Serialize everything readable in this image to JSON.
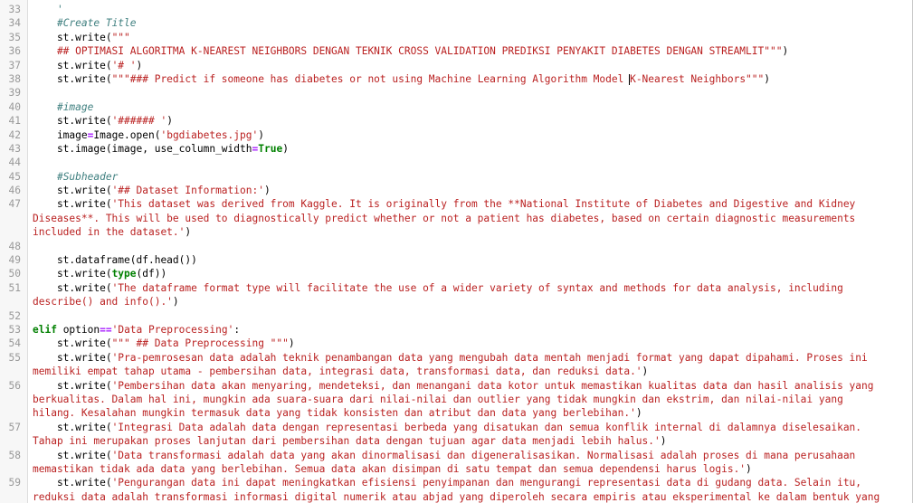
{
  "lines": [
    {
      "n": "33",
      "tokens": [
        {
          "t": "    ' ",
          "c": "cm"
        }
      ]
    },
    {
      "n": "34",
      "tokens": [
        {
          "t": "    "
        },
        {
          "t": "#Create Title",
          "c": "cm"
        }
      ]
    },
    {
      "n": "35",
      "tokens": [
        {
          "t": "    st.write("
        },
        {
          "t": "\"\"\"",
          "c": "str"
        }
      ]
    },
    {
      "n": "36",
      "tokens": [
        {
          "t": "    ## OPTIMASI ALGORITMA K-NEAREST NEIGHBORS DENGAN TEKNIK CROSS VALIDATION PREDIKSI PENYAKIT DIABETES DENGAN STREAMLIT\"\"\"",
          "c": "str"
        },
        {
          "t": ")"
        }
      ]
    },
    {
      "n": "37",
      "tokens": [
        {
          "t": "    st.write("
        },
        {
          "t": "'# '",
          "c": "str"
        },
        {
          "t": ")"
        }
      ]
    },
    {
      "n": "38",
      "tokens": [
        {
          "t": "    st.write("
        },
        {
          "t": "\"\"\"### Predict if someone has diabetes or not using Machine Learning Algorithm Model ",
          "c": "str"
        },
        {
          "t": "|",
          "c": "cursor"
        },
        {
          "t": "K-Nearest Neighbors\"\"\"",
          "c": "str"
        },
        {
          "t": ")"
        }
      ]
    },
    {
      "n": "39",
      "tokens": []
    },
    {
      "n": "40",
      "tokens": [
        {
          "t": "    "
        },
        {
          "t": "#image",
          "c": "cm"
        }
      ]
    },
    {
      "n": "41",
      "tokens": [
        {
          "t": "    st.write("
        },
        {
          "t": "'###### '",
          "c": "str"
        },
        {
          "t": ")"
        }
      ]
    },
    {
      "n": "42",
      "tokens": [
        {
          "t": "    image"
        },
        {
          "t": "=",
          "c": "op"
        },
        {
          "t": "Image.open("
        },
        {
          "t": "'bgdiabetes.jpg'",
          "c": "str"
        },
        {
          "t": ")"
        }
      ]
    },
    {
      "n": "43",
      "tokens": [
        {
          "t": "    st.image(image, use_column_width"
        },
        {
          "t": "=",
          "c": "op"
        },
        {
          "t": "True",
          "c": "kw"
        },
        {
          "t": ")"
        }
      ]
    },
    {
      "n": "44",
      "tokens": []
    },
    {
      "n": "45",
      "tokens": [
        {
          "t": "    "
        },
        {
          "t": "#Subheader",
          "c": "cm"
        }
      ]
    },
    {
      "n": "46",
      "tokens": [
        {
          "t": "    st.write("
        },
        {
          "t": "'## Dataset Information:'",
          "c": "str"
        },
        {
          "t": ")"
        }
      ]
    },
    {
      "n": "47",
      "tokens": [
        {
          "t": "    st.write("
        },
        {
          "t": "'This dataset was derived from Kaggle. It is originally from the **National Institute of Diabetes and Digestive and Kidney",
          "c": "str"
        }
      ]
    },
    {
      "n": "",
      "tokens": [
        {
          "t": "Diseases**. This will be used to diagnostically predict whether or not a patient has diabetes, based on certain diagnostic measurements",
          "c": "str"
        }
      ]
    },
    {
      "n": "",
      "tokens": [
        {
          "t": "included in the dataset.'",
          "c": "str"
        },
        {
          "t": ")"
        }
      ]
    },
    {
      "n": "48",
      "tokens": []
    },
    {
      "n": "49",
      "tokens": [
        {
          "t": "    st.dataframe(df.head())"
        }
      ]
    },
    {
      "n": "50",
      "tokens": [
        {
          "t": "    st.write("
        },
        {
          "t": "type",
          "c": "kw"
        },
        {
          "t": "(df))"
        }
      ]
    },
    {
      "n": "51",
      "tokens": [
        {
          "t": "    st.write("
        },
        {
          "t": "'The dataframe format type will facilitate the use of a wider variety of syntax and methods for data analysis, including",
          "c": "str"
        }
      ]
    },
    {
      "n": "",
      "tokens": [
        {
          "t": "describe() and info().'",
          "c": "str"
        },
        {
          "t": ")"
        }
      ]
    },
    {
      "n": "52",
      "tokens": []
    },
    {
      "n": "53",
      "tokens": [
        {
          "t": "elif",
          "c": "kw"
        },
        {
          "t": " option"
        },
        {
          "t": "==",
          "c": "op"
        },
        {
          "t": "'Data Preprocessing'",
          "c": "str"
        },
        {
          "t": ":"
        }
      ]
    },
    {
      "n": "54",
      "tokens": [
        {
          "t": "    st.write("
        },
        {
          "t": "\"\"\" ## Data Preprocessing \"\"\"",
          "c": "str"
        },
        {
          "t": ")"
        }
      ]
    },
    {
      "n": "55",
      "tokens": [
        {
          "t": "    st.write("
        },
        {
          "t": "'Pra-pemrosesan data adalah teknik penambangan data yang mengubah data mentah menjadi format yang dapat dipahami. Proses ini",
          "c": "str"
        }
      ]
    },
    {
      "n": "",
      "tokens": [
        {
          "t": "memiliki empat tahap utama - pembersihan data, integrasi data, transformasi data, dan reduksi data.'",
          "c": "str"
        },
        {
          "t": ")"
        }
      ]
    },
    {
      "n": "56",
      "tokens": [
        {
          "t": "    st.write("
        },
        {
          "t": "'Pembersihan data akan menyaring, mendeteksi, dan menangani data kotor untuk memastikan kualitas data dan hasil analisis yang",
          "c": "str"
        }
      ]
    },
    {
      "n": "",
      "tokens": [
        {
          "t": "berkualitas. Dalam hal ini, mungkin ada suara-suara dari nilai-nilai dan outlier yang tidak mungkin dan ekstrim, dan nilai-nilai yang",
          "c": "str"
        }
      ]
    },
    {
      "n": "",
      "tokens": [
        {
          "t": "hilang. Kesalahan mungkin termasuk data yang tidak konsisten dan atribut dan data yang berlebihan.'",
          "c": "str"
        },
        {
          "t": ")"
        }
      ]
    },
    {
      "n": "57",
      "tokens": [
        {
          "t": "    st.write("
        },
        {
          "t": "'Integrasi Data adalah data dengan representasi berbeda yang disatukan dan semua konflik internal di dalamnya diselesaikan.",
          "c": "str"
        }
      ]
    },
    {
      "n": "",
      "tokens": [
        {
          "t": "Tahap ini merupakan proses lanjutan dari pembersihan data dengan tujuan agar data menjadi lebih halus.'",
          "c": "str"
        },
        {
          "t": ")"
        }
      ]
    },
    {
      "n": "58",
      "tokens": [
        {
          "t": "    st.write("
        },
        {
          "t": "'Data transformasi adalah data yang akan dinormalisasi dan digeneralisasikan. Normalisasi adalah proses di mana perusahaan",
          "c": "str"
        }
      ]
    },
    {
      "n": "",
      "tokens": [
        {
          "t": "memastikan tidak ada data yang berlebihan. Semua data akan disimpan di satu tempat dan semua dependensi harus logis.'",
          "c": "str"
        },
        {
          "t": ")"
        }
      ]
    },
    {
      "n": "59",
      "tokens": [
        {
          "t": "    st.write("
        },
        {
          "t": "'Pengurangan data ini dapat meningkatkan efisiensi penyimpanan dan mengurangi representasi data di gudang data. Selain itu,",
          "c": "str"
        }
      ]
    },
    {
      "n": "",
      "tokens": [
        {
          "t": "reduksi data adalah transformasi informasi digital numerik atau abjad yang diperoleh secara empiris atau eksperimental ke dalam bentuk yang",
          "c": "str"
        }
      ]
    }
  ]
}
